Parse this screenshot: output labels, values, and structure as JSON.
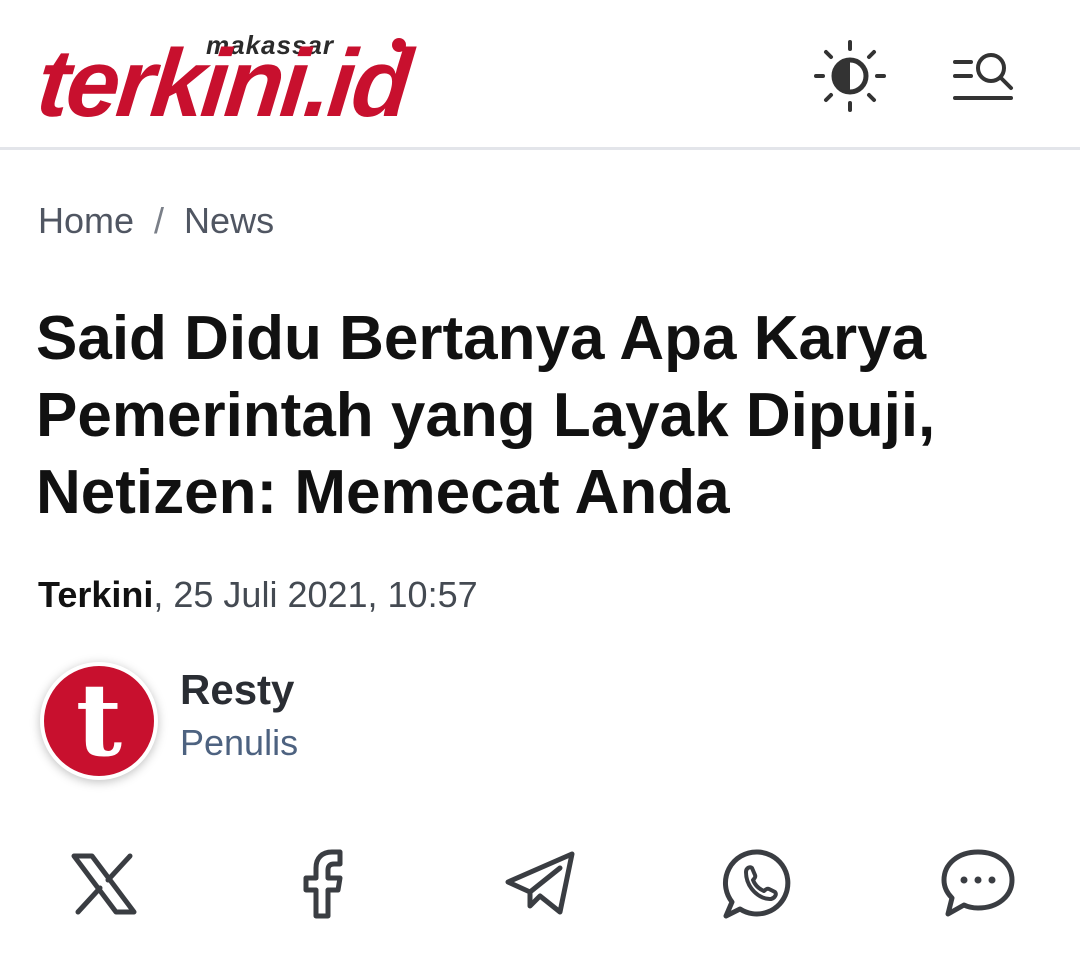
{
  "logo": {
    "sub": "makassar",
    "main": "terkini.id"
  },
  "header": {
    "theme_icon": "sun-half-icon",
    "search_icon": "menu-search-icon"
  },
  "breadcrumb": {
    "home": "Home",
    "separator": "/",
    "current": "News"
  },
  "article": {
    "title": "Said Didu Bertanya Apa Karya Pemerintah yang Layak Dipuji, Netizen: Memecat Anda",
    "source": "Terkini",
    "datetime": ", 25 Juli 2021, 10:57"
  },
  "author": {
    "avatar_letter": "t",
    "name": "Resty",
    "role": "Penulis"
  },
  "share": {
    "icons": [
      "x-icon",
      "facebook-icon",
      "telegram-icon",
      "whatsapp-icon",
      "comment-icon"
    ]
  },
  "colors": {
    "brand": "#c8102e",
    "text": "#111111",
    "muted": "#505662",
    "role": "#4d6280"
  }
}
